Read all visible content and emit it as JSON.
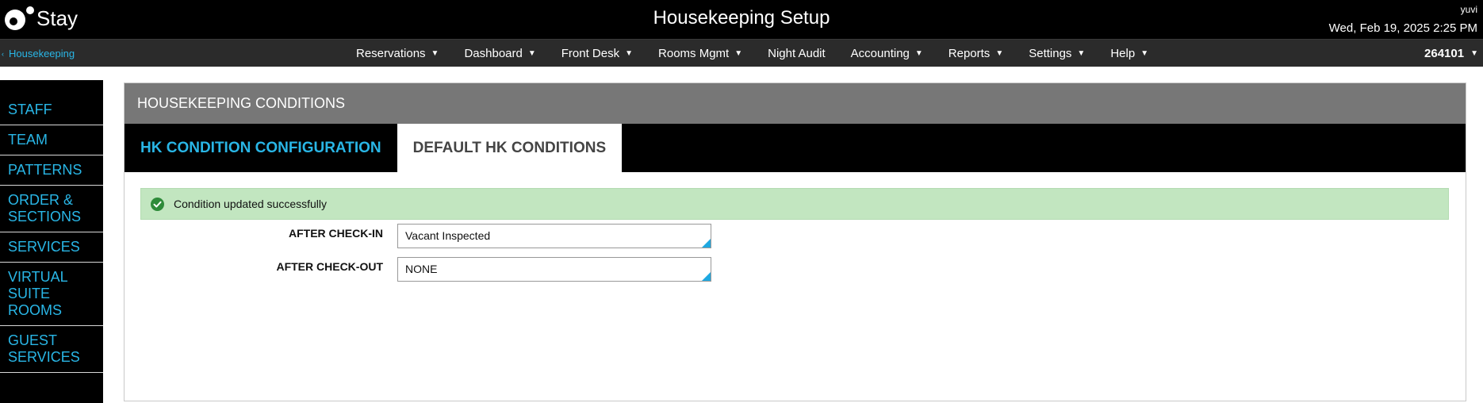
{
  "app": {
    "logo_text": "Stay",
    "page_title": "Housekeeping Setup",
    "user": "yuvi",
    "datetime": "Wed, Feb 19, 2025 2:25 PM"
  },
  "breadcrumb": {
    "label": "Housekeeping"
  },
  "nav": {
    "items": [
      {
        "label": "Reservations",
        "dropdown": true
      },
      {
        "label": "Dashboard",
        "dropdown": true
      },
      {
        "label": "Front Desk",
        "dropdown": true
      },
      {
        "label": "Rooms Mgmt",
        "dropdown": true
      },
      {
        "label": "Night Audit",
        "dropdown": false
      },
      {
        "label": "Accounting",
        "dropdown": true
      },
      {
        "label": "Reports",
        "dropdown": true
      },
      {
        "label": "Settings",
        "dropdown": true
      },
      {
        "label": "Help",
        "dropdown": true
      }
    ],
    "property": "264101"
  },
  "sidebar": {
    "items": [
      {
        "label": "STAFF"
      },
      {
        "label": "TEAM"
      },
      {
        "label": "PATTERNS"
      },
      {
        "label": "ORDER & SECTIONS"
      },
      {
        "label": "SERVICES"
      },
      {
        "label": "VIRTUAL SUITE ROOMS"
      },
      {
        "label": "GUEST SERVICES"
      }
    ]
  },
  "panel": {
    "header": "HOUSEKEEPING CONDITIONS",
    "tabs": [
      {
        "label": "HK CONDITION CONFIGURATION",
        "active": false
      },
      {
        "label": "DEFAULT HK CONDITIONS",
        "active": true
      }
    ],
    "alert": {
      "message": "Condition updated successfully",
      "icon": "check-circle-icon",
      "color": "#c2e6c0"
    },
    "fields": [
      {
        "label": "AFTER CHECK-IN",
        "value": "Vacant Inspected"
      },
      {
        "label": "AFTER CHECK-OUT",
        "value": "NONE"
      }
    ]
  },
  "colors": {
    "accent": "#29b6e6",
    "topbar": "#000000",
    "navbar": "#2b2b2b",
    "panel_header": "#777777",
    "success": "#2e8b3a"
  }
}
